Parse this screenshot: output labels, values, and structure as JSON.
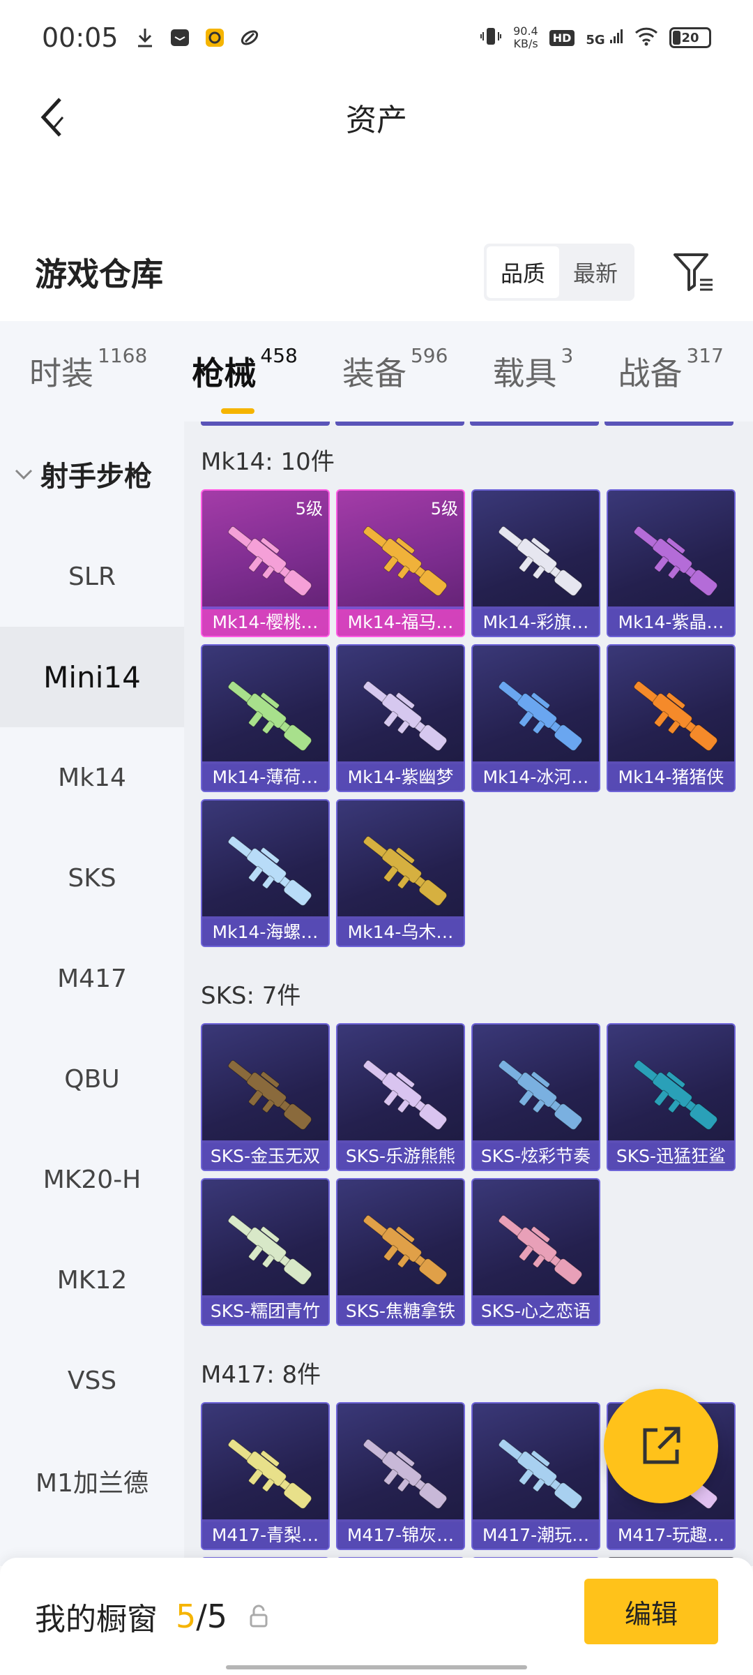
{
  "status_bar": {
    "time": "00:05",
    "net_speed_value": "90.4",
    "net_speed_unit": "KB/s",
    "hd": "HD",
    "signal": "5G",
    "battery": "20"
  },
  "nav": {
    "title": "资产"
  },
  "warehouse": {
    "title": "游戏仓库",
    "sort_options": [
      "品质",
      "最新"
    ],
    "active_sort": "品质"
  },
  "category_tabs": [
    {
      "label": "时装",
      "count": "1168"
    },
    {
      "label": "枪械",
      "count": "458"
    },
    {
      "label": "装备",
      "count": "596"
    },
    {
      "label": "载具",
      "count": "3"
    },
    {
      "label": "战备",
      "count": "317"
    }
  ],
  "active_category": "枪械",
  "sidebar": {
    "group": "射手步枪",
    "items": [
      "SLR",
      "Mini14",
      "Mk14",
      "SKS",
      "M417",
      "QBU",
      "MK20-H",
      "MK12",
      "VSS",
      "M1加兰德"
    ],
    "active_item": "Mini14"
  },
  "groups": [
    {
      "title": "Mk14: 10件",
      "items": [
        {
          "name": "Mk14-樱桃…",
          "level": "5级",
          "rarity": "legendary",
          "color": "#f5a0d8"
        },
        {
          "name": "Mk14-福马…",
          "level": "5级",
          "rarity": "legendary",
          "color": "#f0b23a"
        },
        {
          "name": "Mk14-彩旗…",
          "color": "#e6e6f0"
        },
        {
          "name": "Mk14-紫晶…",
          "color": "#b46cd8"
        },
        {
          "name": "Mk14-薄荷…",
          "color": "#a8e08c"
        },
        {
          "name": "Mk14-紫幽梦",
          "color": "#d6c8ef"
        },
        {
          "name": "Mk14-冰河…",
          "color": "#6aa6f0"
        },
        {
          "name": "Mk14-猪猪侠",
          "color": "#f58a2a"
        },
        {
          "name": "Mk14-海螺…",
          "color": "#b8dcf8"
        },
        {
          "name": "Mk14-乌木…",
          "color": "#d6b040"
        }
      ]
    },
    {
      "title": "SKS: 7件",
      "items": [
        {
          "name": "SKS-金玉无双",
          "color": "#8a6a3c"
        },
        {
          "name": "SKS-乐游熊熊",
          "color": "#d9c4f0"
        },
        {
          "name": "SKS-炫彩节奏",
          "color": "#7ab0e0"
        },
        {
          "name": "SKS-迅猛狂鲨",
          "color": "#2aa0b8"
        },
        {
          "name": "SKS-糯团青竹",
          "color": "#d8e8c8"
        },
        {
          "name": "SKS-焦糖拿铁",
          "color": "#e0a048"
        },
        {
          "name": "SKS-心之恋语",
          "color": "#e8a0b8"
        }
      ]
    },
    {
      "title": "M417: 8件",
      "items": [
        {
          "name": "M417-青梨…",
          "color": "#e8e08a"
        },
        {
          "name": "M417-锦灰…",
          "color": "#c8b8d8"
        },
        {
          "name": "M417-潮玩…",
          "color": "#a8d0f0"
        },
        {
          "name": "M417-玩趣…",
          "color": "#e0c0f0"
        },
        {
          "name": "",
          "color": "#5a54b8"
        },
        {
          "name": "",
          "color": "#5a54b8"
        },
        {
          "name": "",
          "color": "#5a54b8"
        },
        {
          "name": "",
          "color": "#888888"
        }
      ]
    }
  ],
  "bottom_bar": {
    "label": "我的橱窗",
    "current": "5",
    "total": "5",
    "edit_label": "编辑"
  },
  "accent_color": "#ffc21a"
}
